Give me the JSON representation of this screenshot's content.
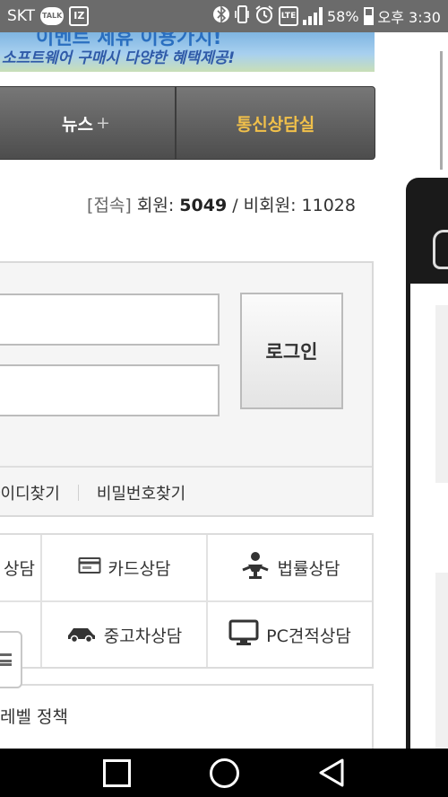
{
  "status_bar": {
    "carrier": "SKT",
    "talk_icon_label": "TALK",
    "app_icon_label": "IZ",
    "lte_label": "LTE",
    "battery_percent": "58%",
    "time": "오후 3:30",
    "battery_level": 0.58
  },
  "banner": {
    "headline_partial": "이벤트 제휴 이용가치!",
    "subtext": "소프트웨어 구매시 다양한 혜택제공!"
  },
  "nav": {
    "news_label": "뉴스",
    "news_plus": "+",
    "comm_label": "통신상담실"
  },
  "visitors": {
    "tag": "[접속]",
    "members_label": "회원: ",
    "members_count": "5049",
    "separator": " / ",
    "guests_label": "비회원: ",
    "guests_count": "11028"
  },
  "login": {
    "id_value": "",
    "pw_value": "",
    "button_label": "로그인",
    "find_id_label": "아이디찾기",
    "find_pw_label": "비밀번호찾기"
  },
  "consult": {
    "items": [
      {
        "label": "상담",
        "icon": "partial-icon"
      },
      {
        "label": "카드상담",
        "icon": "card-icon"
      },
      {
        "label": "법률상담",
        "icon": "law-icon"
      },
      {
        "label": "중고차상담",
        "icon": "car-icon"
      },
      {
        "label": "PC견적상담",
        "icon": "monitor-icon"
      }
    ]
  },
  "policy": {
    "label": "레벨 정책"
  },
  "colors": {
    "nav_accent": "#f1c04a",
    "status_bar": "#6b6b6b",
    "banner_text": "#2f5aa8"
  }
}
